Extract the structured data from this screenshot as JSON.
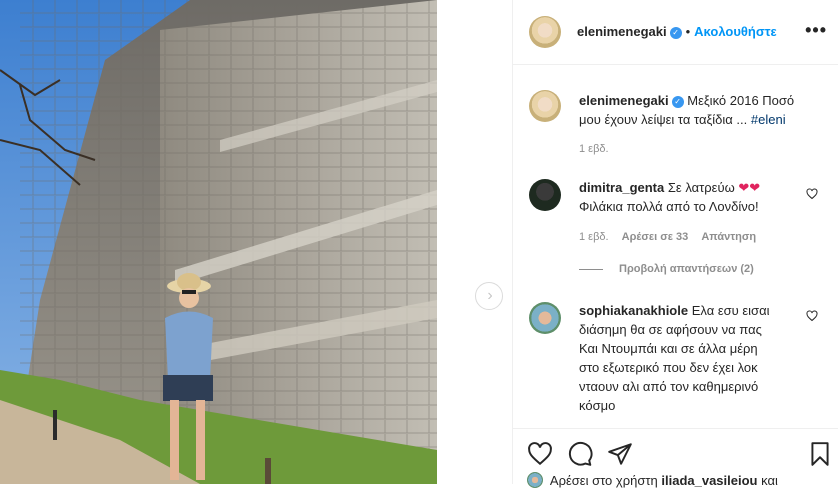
{
  "post": {
    "author": "elenimenegaki",
    "follow_label": "Ακολουθήστε",
    "separator": "•",
    "more_label": "•••",
    "caption_text": "Μεξικό 2016 Ποσό μου έχουν λείψει τα ταξίδια ...",
    "caption_line1": "Μεξικό 2016 Ποσό",
    "caption_line2": "μου έχουν λείψει τα ταξίδια ...",
    "caption_tag": "#eleni",
    "caption_time": "1 εβδ."
  },
  "comments": [
    {
      "user": "dimitra_genta",
      "line1": "Σε λατρεύω",
      "emoji": "❤❤",
      "line2": "Φιλάκια πολλά από το Λονδίνο!",
      "time": "1 εβδ.",
      "likes": "Αρέσει σε 33",
      "reply": "Απάντηση",
      "view_replies": "Προβολή απαντήσεων (2)"
    },
    {
      "user": "sophiakanakhiole",
      "line1": "Ελα εσυ εισαι",
      "line2": "διάσημη θα σε αφήσουν να πας",
      "line3": "Και Ντουμπάι και σε άλλα μέρη",
      "line4": "στο εξωτερικό που δεν έχει λοκ",
      "line5": "νταουν αλι από τον καθημερινό",
      "line6": "κόσμο"
    }
  ],
  "footer": {
    "liked_by_prefix": "Αρέσει στο χρήστη",
    "liked_by_user": "iliada_vasileiou",
    "liked_by_suffix": "και"
  },
  "icons": {
    "like": "heart-icon",
    "comment": "comment-bubble-icon",
    "share": "paper-plane-icon",
    "save": "bookmark-icon",
    "next": "chevron-right-icon",
    "verified": "verified-badge-icon"
  },
  "colors": {
    "link": "#0095f6",
    "verified": "#3897f0",
    "heart": "#ed4956",
    "meta": "#8e8e8e"
  }
}
